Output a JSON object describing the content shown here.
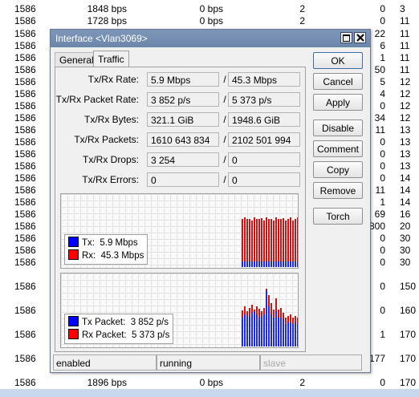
{
  "background_table": {
    "rows": [
      {
        "a": "1586",
        "b": "1848 bps",
        "c": "0 bps",
        "d": "2",
        "e": "0",
        "f": "3"
      },
      {
        "a": "1586",
        "b": "1728 bps",
        "c": "0 bps",
        "d": "2",
        "e": "0",
        "f": "11"
      },
      {
        "a": "1586",
        "b": "",
        "c": "",
        "d": "",
        "e": "22",
        "f": "11"
      },
      {
        "a": "1586",
        "b": "",
        "c": "",
        "d": "",
        "e": "6",
        "f": "11"
      },
      {
        "a": "1586",
        "b": "",
        "c": "",
        "d": "",
        "e": "1",
        "f": "11"
      },
      {
        "a": "1586",
        "b": "",
        "c": "",
        "d": "",
        "e": "50",
        "f": "11"
      },
      {
        "a": "1586",
        "b": "",
        "c": "",
        "d": "",
        "e": "5",
        "f": "12"
      },
      {
        "a": "1586",
        "b": "",
        "c": "",
        "d": "",
        "e": "4",
        "f": "12"
      },
      {
        "a": "1586",
        "b": "",
        "c": "",
        "d": "",
        "e": "0",
        "f": "12"
      },
      {
        "a": "1586",
        "b": "",
        "c": "",
        "d": "",
        "e": "34",
        "f": "12"
      },
      {
        "a": "1586",
        "b": "",
        "c": "",
        "d": "",
        "e": "11",
        "f": "13"
      },
      {
        "a": "1586",
        "b": "",
        "c": "",
        "d": "",
        "e": "0",
        "f": "13"
      },
      {
        "a": "1586",
        "b": "",
        "c": "",
        "d": "",
        "e": "0",
        "f": "13"
      },
      {
        "a": "1586",
        "b": "",
        "c": "",
        "d": "",
        "e": "0",
        "f": "13"
      },
      {
        "a": "1586",
        "b": "",
        "c": "",
        "d": "",
        "e": "0",
        "f": "14"
      },
      {
        "a": "1586",
        "b": "",
        "c": "",
        "d": "",
        "e": "11",
        "f": "14"
      },
      {
        "a": "1586",
        "b": "",
        "c": "",
        "d": "",
        "e": "1",
        "f": "14"
      },
      {
        "a": "1586",
        "b": "",
        "c": "",
        "d": "",
        "e": "69",
        "f": "16"
      },
      {
        "a": "1586",
        "b": "",
        "c": "",
        "d": "",
        "e": "800",
        "f": "20"
      },
      {
        "a": "1586",
        "b": "",
        "c": "",
        "d": "",
        "e": "0",
        "f": "30"
      },
      {
        "a": "1586",
        "b": "",
        "c": "",
        "d": "",
        "e": "0",
        "f": "30"
      },
      {
        "a": "1586",
        "b": "",
        "c": "",
        "d": "",
        "e": "0",
        "f": "30"
      },
      {
        "a": "1586",
        "b": "",
        "c": "",
        "d": "",
        "e": "0",
        "f": "150"
      },
      {
        "a": "1586",
        "b": "",
        "c": "",
        "d": "",
        "e": "0",
        "f": "160"
      },
      {
        "a": "1586",
        "b": "",
        "c": "",
        "d": "",
        "e": "1",
        "f": "170"
      },
      {
        "a": "1586",
        "b": "",
        "c": "",
        "d": "",
        "e": "177",
        "f": "170"
      },
      {
        "a": "1586",
        "b": "1896 bps",
        "c": "0 bps",
        "d": "2",
        "e": "0",
        "f": "170"
      }
    ]
  },
  "window": {
    "title": "Interface <Vlan3069>",
    "tabs": [
      "General",
      "Traffic"
    ],
    "fields": [
      {
        "label": "Tx/Rx Rate:",
        "tx": "5.9 Mbps",
        "rx": "45.3 Mbps"
      },
      {
        "label": "Tx/Rx Packet Rate:",
        "tx": "3 852 p/s",
        "rx": "5 373 p/s"
      },
      {
        "label": "Tx/Rx Bytes:",
        "tx": "321.1 GiB",
        "rx": "1948.6 GiB"
      },
      {
        "label": "Tx/Rx Packets:",
        "tx": "1610 643 834",
        "rx": "2102 501 994"
      },
      {
        "label": "Tx/Rx Drops:",
        "tx": "3 254",
        "rx": "0"
      },
      {
        "label": "Tx/Rx Errors:",
        "tx": "0",
        "rx": "0"
      }
    ],
    "separator": "/",
    "buttons": [
      "OK",
      "Cancel",
      "Apply",
      "Disable",
      "Comment",
      "Copy",
      "Remove",
      "Torch"
    ],
    "graph_rate": {
      "legend": [
        {
          "label": "Tx:",
          "value": "5.9 Mbps",
          "color": "#0000ff"
        },
        {
          "label": "Rx:",
          "value": "45.3 Mbps",
          "color": "#ff0000"
        }
      ]
    },
    "graph_packets": {
      "legend": [
        {
          "label": "Tx Packet:",
          "value": "3 852 p/s",
          "color": "#0000ff"
        },
        {
          "label": "Rx Packet:",
          "value": "5 373 p/s",
          "color": "#ff0000"
        }
      ]
    },
    "status": [
      "enabled",
      "running",
      "slave"
    ],
    "colors": {
      "tx": "#1f2bd6",
      "rx": "#c81414",
      "titlebar": "#7390b4"
    }
  }
}
